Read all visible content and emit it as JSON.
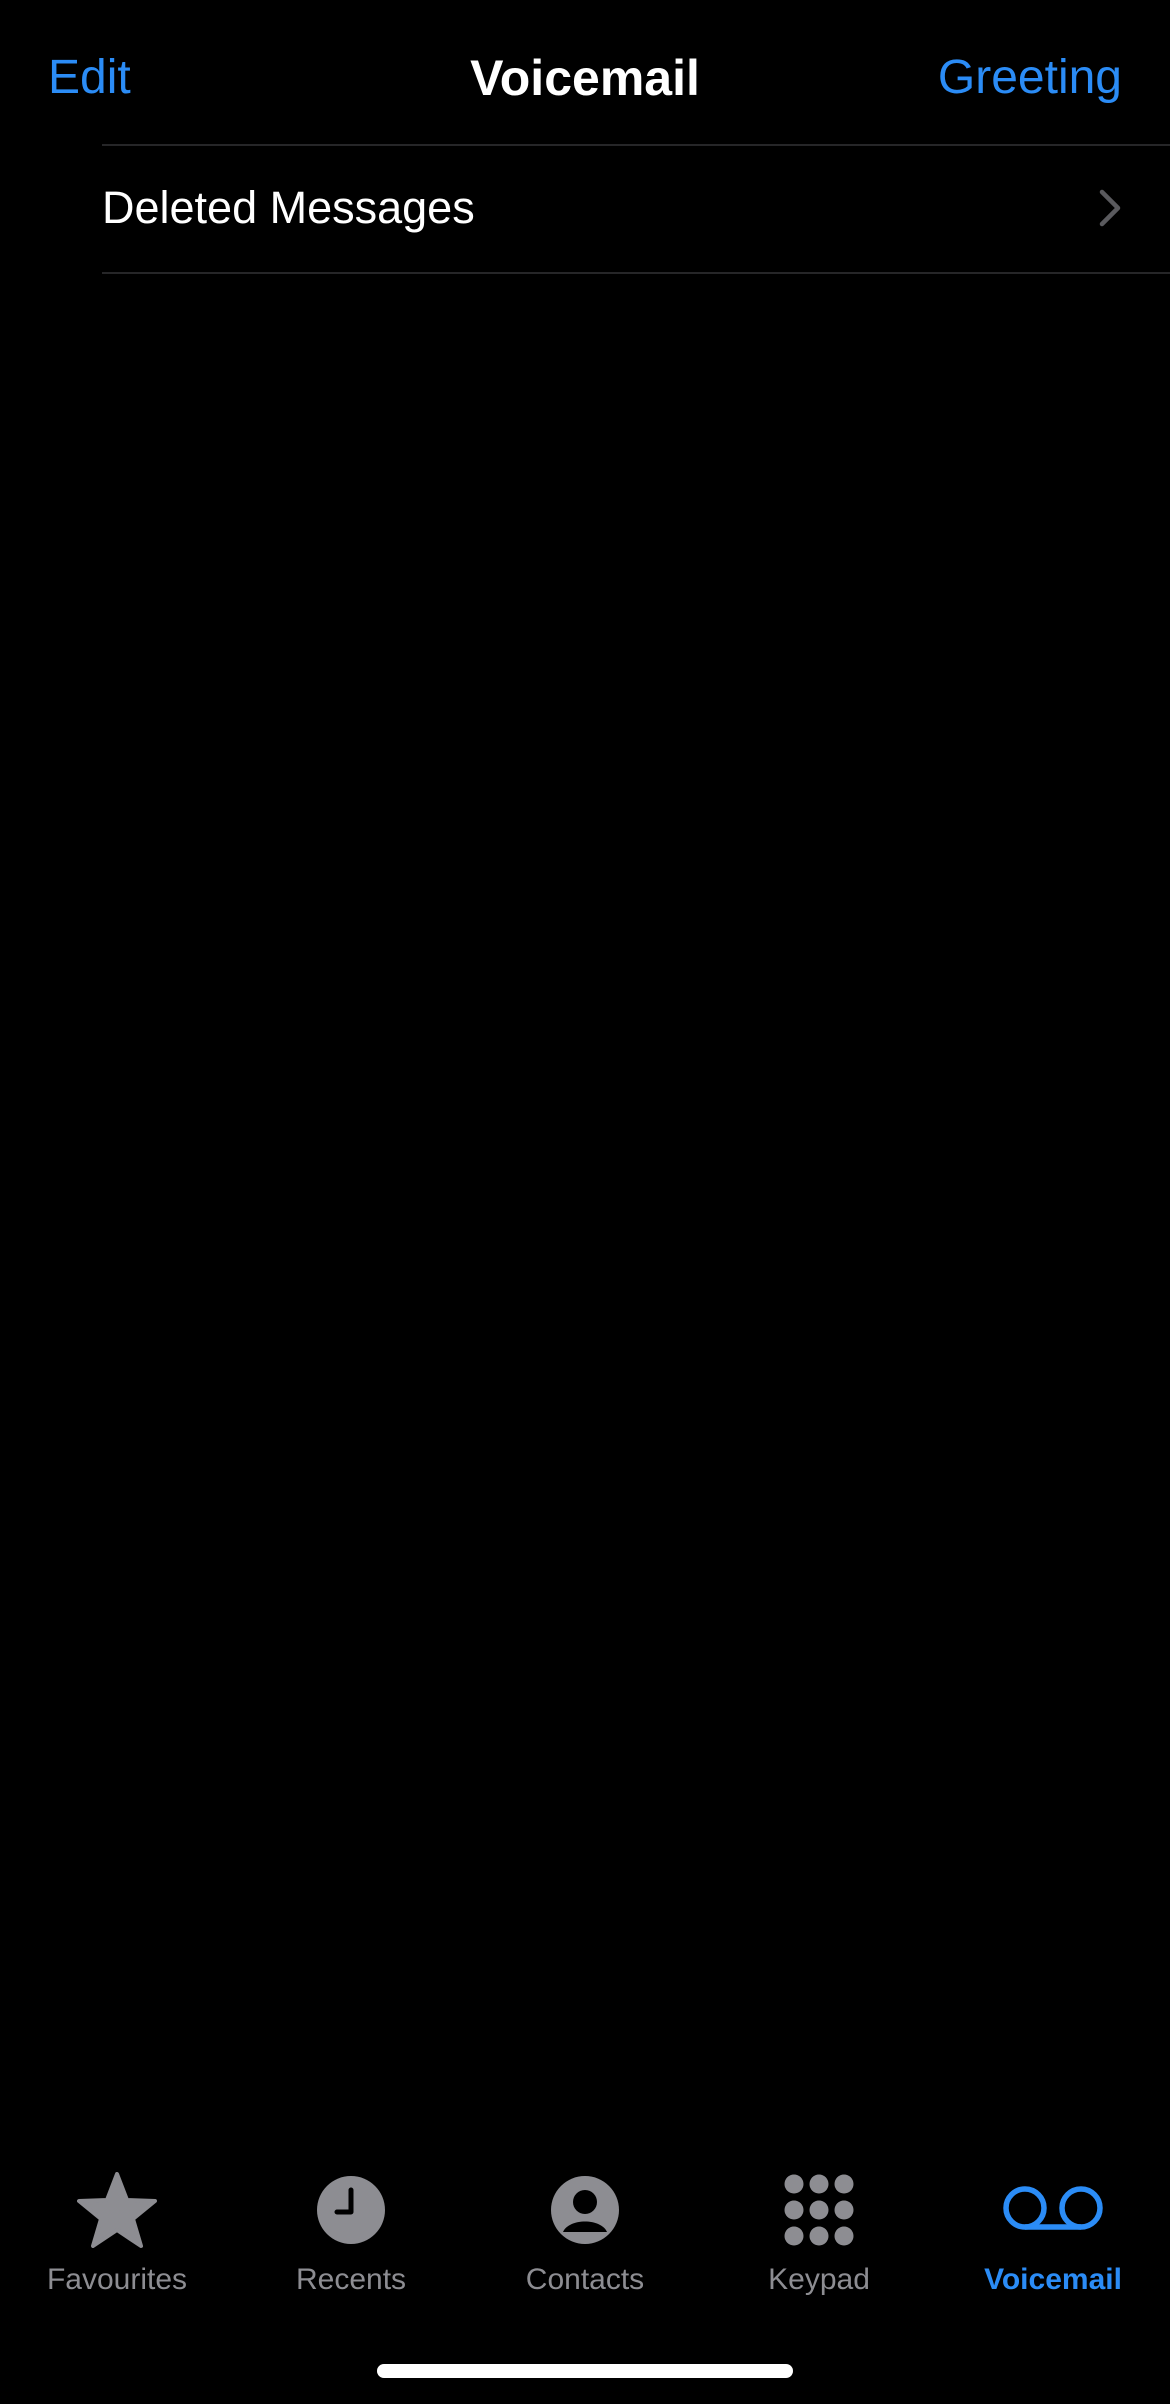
{
  "colors": {
    "accent": "#2b8cf6",
    "background": "#000000",
    "inactive": "#8d8d92",
    "separator": "#262628"
  },
  "nav": {
    "left_button": "Edit",
    "title": "Voicemail",
    "right_button": "Greeting"
  },
  "list": {
    "items": [
      {
        "label": "Deleted Messages",
        "icon": "chevron-right-icon"
      }
    ]
  },
  "tab_bar": {
    "tabs": [
      {
        "label": "Favourites",
        "icon": "star-icon",
        "active": false
      },
      {
        "label": "Recents",
        "icon": "clock-icon",
        "active": false
      },
      {
        "label": "Contacts",
        "icon": "person-circle-icon",
        "active": false
      },
      {
        "label": "Keypad",
        "icon": "keypad-icon",
        "active": false
      },
      {
        "label": "Voicemail",
        "icon": "voicemail-icon",
        "active": true
      }
    ]
  }
}
